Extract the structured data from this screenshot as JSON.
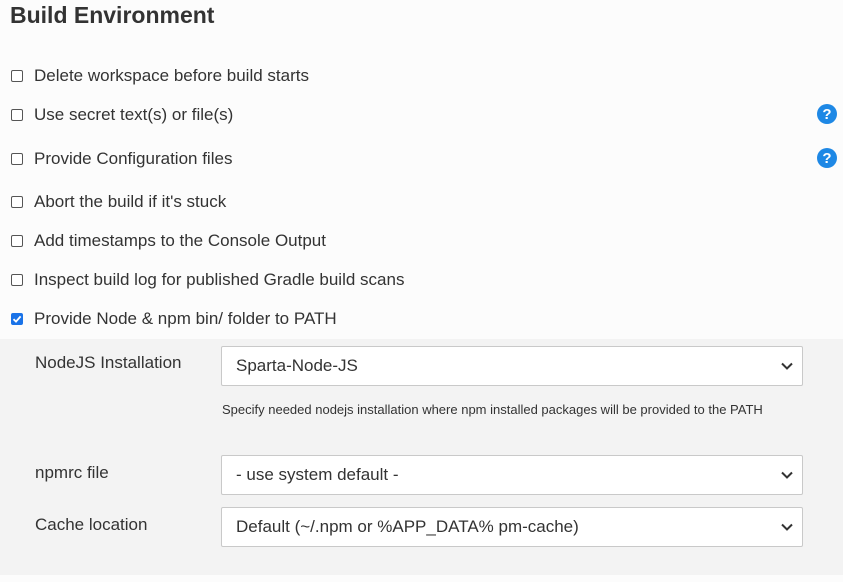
{
  "section_title": "Build Environment",
  "options": [
    {
      "label": "Delete workspace before build starts",
      "checked": false,
      "help": false
    },
    {
      "label": "Use secret text(s) or file(s)",
      "checked": false,
      "help": true
    },
    {
      "label": "Provide Configuration files",
      "checked": false,
      "help": true
    },
    {
      "label": "Abort the build if it's stuck",
      "checked": false,
      "help": false
    },
    {
      "label": "Add timestamps to the Console Output",
      "checked": false,
      "help": false
    },
    {
      "label": "Inspect build log for published Gradle build scans",
      "checked": false,
      "help": false
    },
    {
      "label": "Provide Node & npm bin/ folder to PATH",
      "checked": true,
      "help": false
    }
  ],
  "help_icon_glyph": "?",
  "nodejs": {
    "label": "NodeJS Installation",
    "value": "Sparta-Node-JS",
    "hint": "Specify needed nodejs installation where npm installed packages will be provided to the PATH"
  },
  "npmrc": {
    "label": "npmrc file",
    "value": "- use system default -"
  },
  "cache": {
    "label": "Cache location",
    "value": "Default (~/.npm or %APP_DATA% pm-cache)"
  },
  "colors": {
    "accent": "#1a73e8",
    "help": "#1e88e5",
    "panel": "#f3f3f3"
  }
}
